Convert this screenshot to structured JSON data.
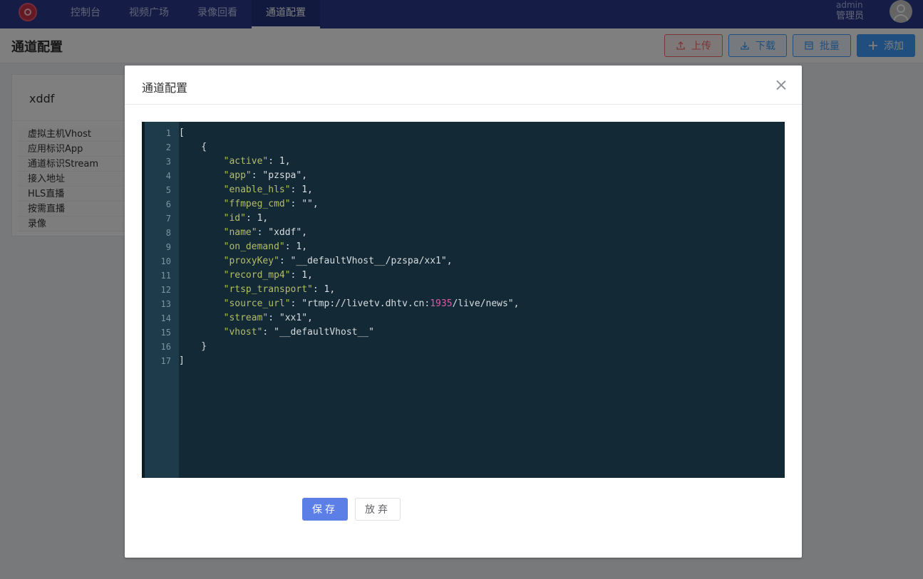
{
  "nav": {
    "items": [
      {
        "label": "控制台"
      },
      {
        "label": "视频广场"
      },
      {
        "label": "录像回看"
      },
      {
        "label": "通道配置"
      }
    ],
    "active_index": 3,
    "user": {
      "name": "admin",
      "role": "管理员"
    }
  },
  "page": {
    "title": "通道配置",
    "toolbar": {
      "upload": "上传",
      "download": "下载",
      "batch": "批量",
      "add": "添加"
    }
  },
  "card": {
    "title": "xddf",
    "fields": [
      "虚拟主机Vhost",
      "应用标识App",
      "通道标识Stream",
      "接入地址",
      "HLS直播",
      "按需直播",
      "录像"
    ]
  },
  "dialog": {
    "title": "通道配置",
    "save_label": "保存",
    "cancel_label": "放弃",
    "code_lines": [
      "[",
      "    {",
      "        \"active\": 1,",
      "        \"app\": \"pzspa\",",
      "        \"enable_hls\": 1,",
      "        \"ffmpeg_cmd\": \"\",",
      "        \"id\": 1,",
      "        \"name\": \"xddf\",",
      "        \"on_demand\": 1,",
      "        \"proxyKey\": \"__defaultVhost__/pzspa/xx1\",",
      "        \"record_mp4\": 1,",
      "        \"rtsp_transport\": 1,",
      "        \"source_url\": \"rtmp://livetv.dhtv.cn:1935/live/news\",",
      "        \"stream\": \"xx1\",",
      "        \"vhost\": \"__defaultVhost__\"",
      "    }",
      "]"
    ]
  },
  "colors": {
    "nav_bg": "#2b3a8c",
    "editor_bg": "#132935",
    "primary": "#409eff",
    "danger": "#f56c6c"
  }
}
